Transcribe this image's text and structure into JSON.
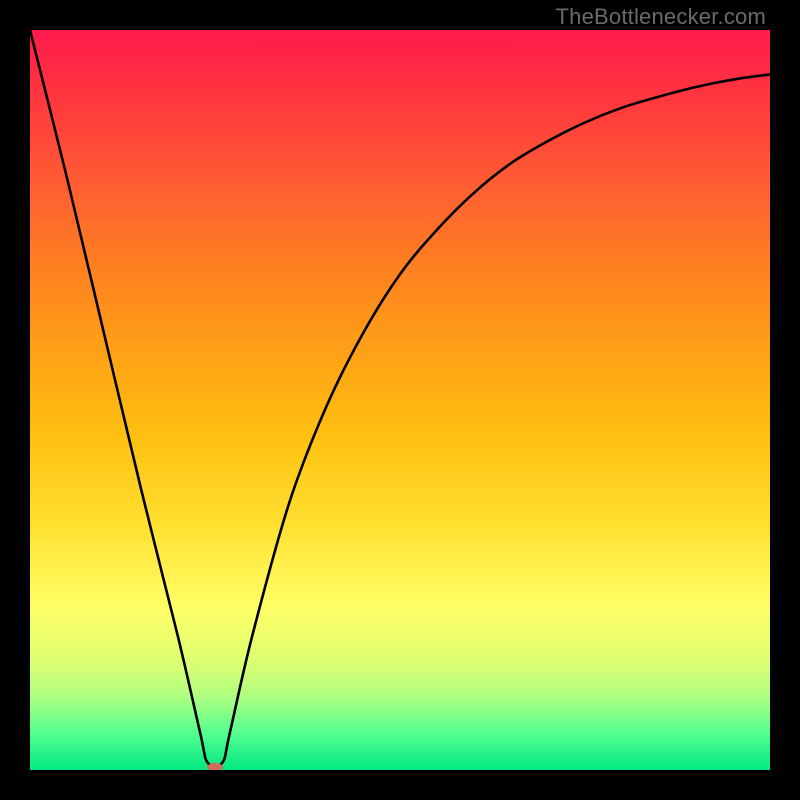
{
  "attribution": "TheBottlenecker.com",
  "chart_data": {
    "type": "line",
    "title": "",
    "xlabel": "",
    "ylabel": "",
    "xlim": [
      0,
      100
    ],
    "ylim": [
      0,
      100
    ],
    "series": [
      {
        "name": "bottleneck-curve",
        "x": [
          0,
          5,
          10,
          15,
          20,
          23,
          24,
          26,
          27,
          30,
          35,
          40,
          45,
          50,
          55,
          60,
          65,
          70,
          75,
          80,
          85,
          90,
          95,
          100
        ],
        "y": [
          100,
          80,
          59,
          38,
          18,
          5,
          1,
          1,
          5,
          18,
          36,
          49,
          59,
          67,
          73,
          78,
          82,
          85,
          87.5,
          89.5,
          91,
          92.3,
          93.3,
          94
        ]
      }
    ],
    "marker": {
      "x": 25,
      "y": 0.4,
      "color": "#d46a5a",
      "rx": 8,
      "ry": 4
    },
    "gradient_stops": [
      {
        "pos": 0.0,
        "color": "#ff1a4d"
      },
      {
        "pos": 0.08,
        "color": "#ff3340"
      },
      {
        "pos": 0.2,
        "color": "#ff5a33"
      },
      {
        "pos": 0.32,
        "color": "#ff8020"
      },
      {
        "pos": 0.45,
        "color": "#ffa515"
      },
      {
        "pos": 0.55,
        "color": "#ffc010"
      },
      {
        "pos": 0.67,
        "color": "#ffe030"
      },
      {
        "pos": 0.78,
        "color": "#ffff66"
      },
      {
        "pos": 0.85,
        "color": "#e0ff70"
      },
      {
        "pos": 0.9,
        "color": "#b0ff80"
      },
      {
        "pos": 0.95,
        "color": "#55ff90"
      },
      {
        "pos": 1.0,
        "color": "#00e880"
      }
    ]
  }
}
